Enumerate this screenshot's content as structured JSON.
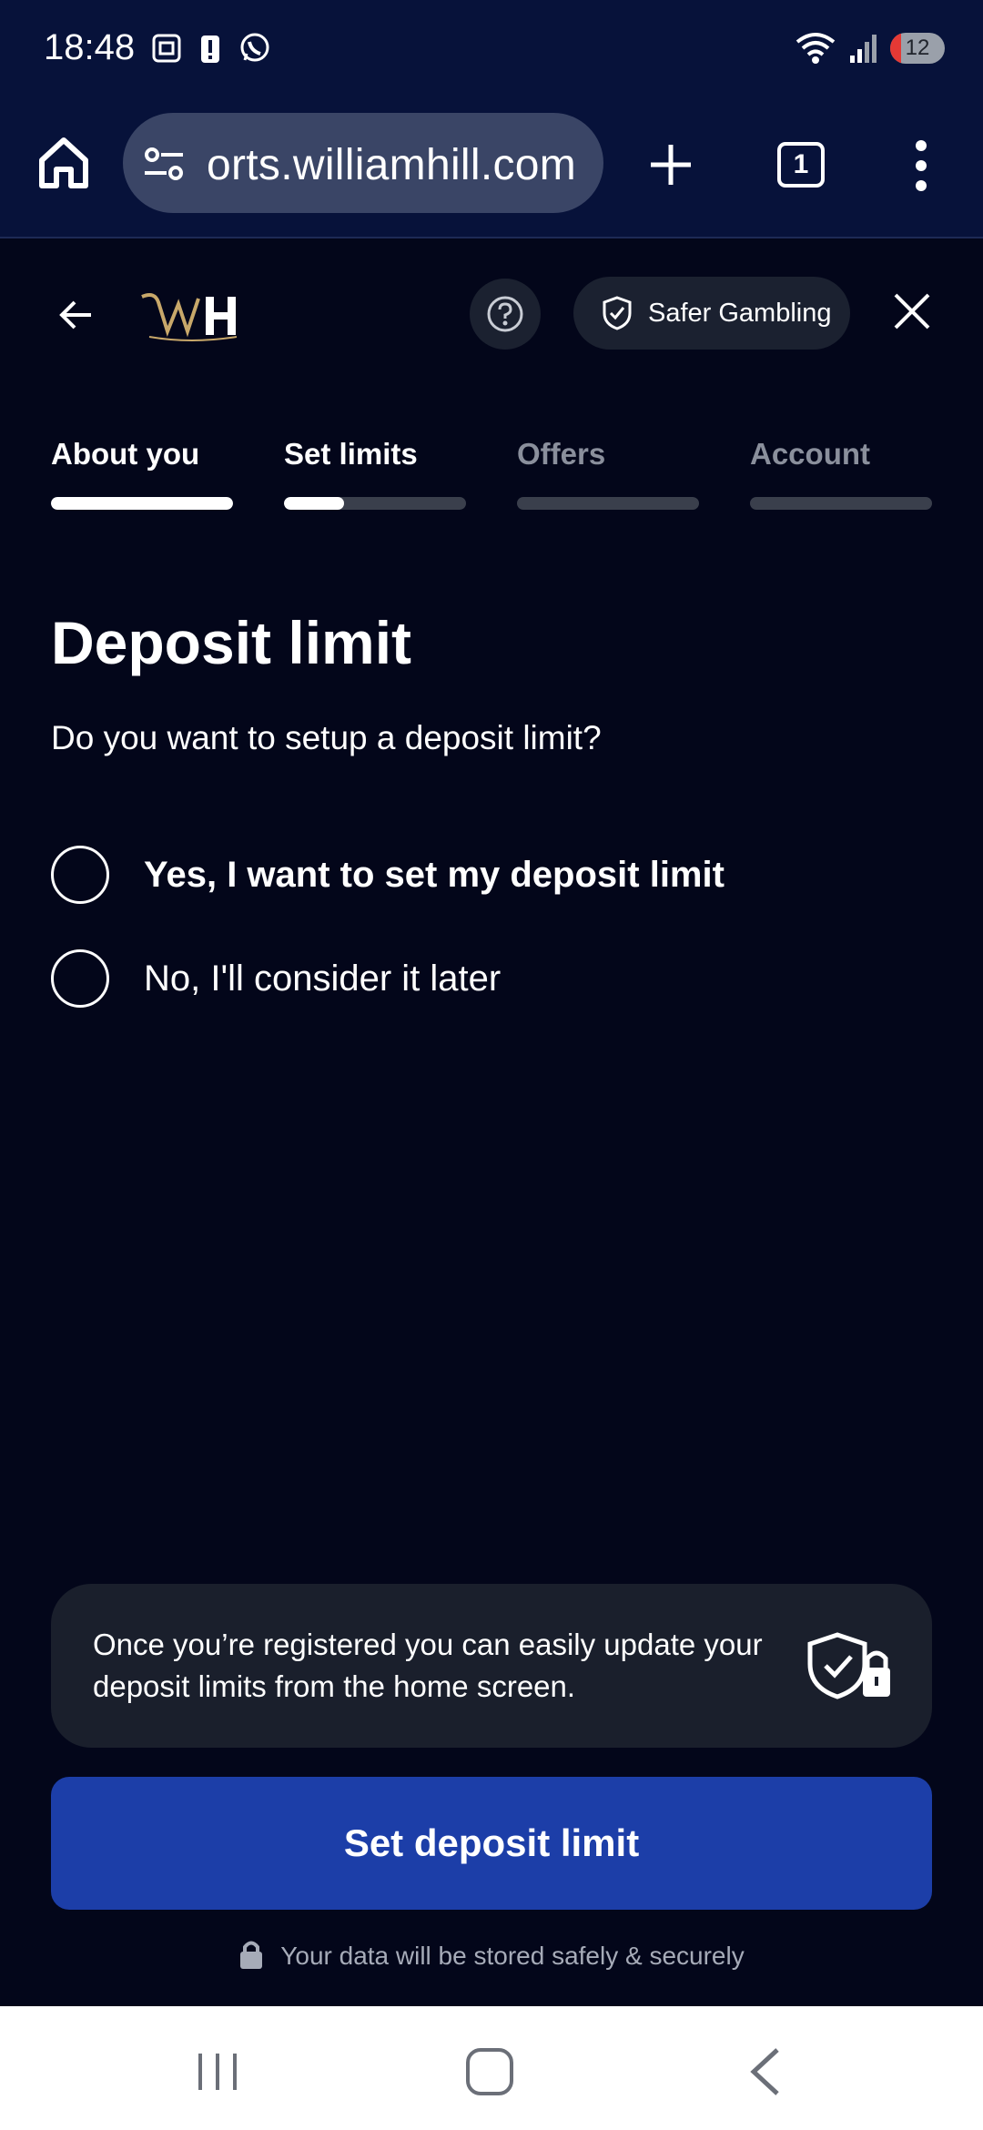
{
  "status_bar": {
    "time": "18:48",
    "battery": "12"
  },
  "browser": {
    "url": "orts.williamhill.com",
    "tab_count": "1"
  },
  "header": {
    "safer_gambling_label": "Safer Gambling"
  },
  "steps": [
    {
      "label": "About you",
      "progress": 1.0,
      "active": true
    },
    {
      "label": "Set limits",
      "progress": 0.33,
      "active": true
    },
    {
      "label": "Offers",
      "progress": 0,
      "active": false
    },
    {
      "label": "Account",
      "progress": 0,
      "active": false
    }
  ],
  "main": {
    "title": "Deposit limit",
    "question": "Do you want to setup a deposit limit?",
    "options": [
      {
        "label": "Yes, I want to set my deposit limit",
        "selected": false
      },
      {
        "label": "No, I'll consider it later",
        "selected": false
      }
    ],
    "info_text": "Once you’re registered you can easily update your deposit limits from the home screen.",
    "cta_label": "Set deposit limit",
    "secure_note": "Your data will be stored safely & securely"
  },
  "colors": {
    "background": "#03061a",
    "browser_bar": "#07123a",
    "cta": "#1c3ea8",
    "panel": "#1a1f2c"
  }
}
